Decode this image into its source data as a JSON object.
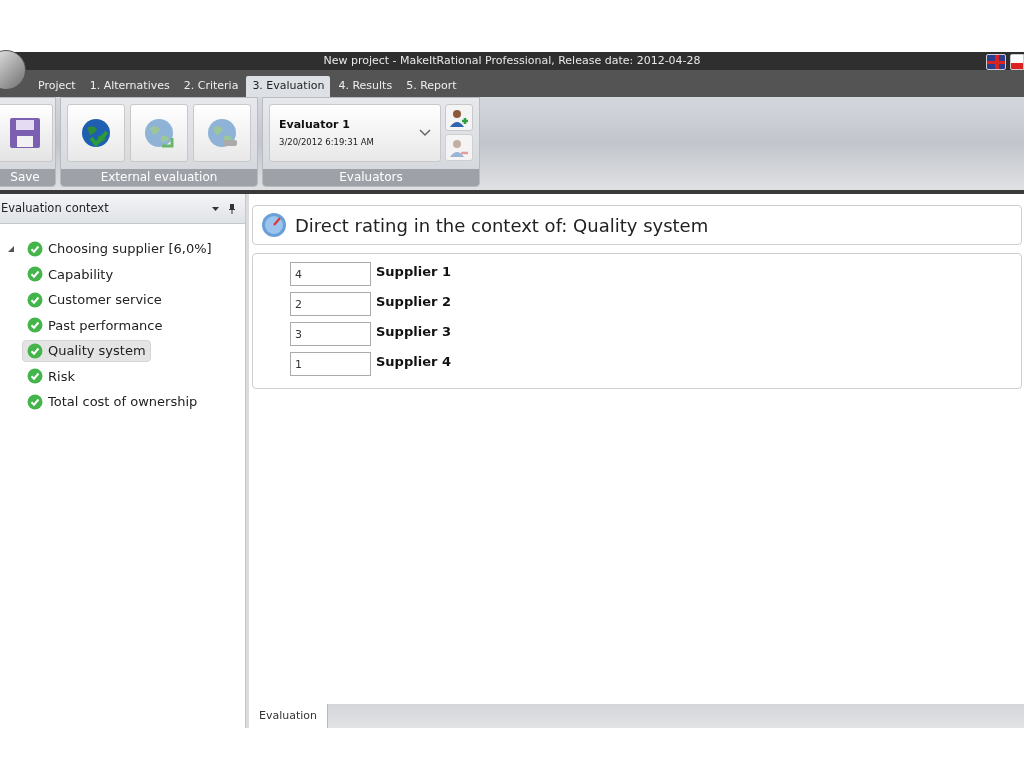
{
  "window": {
    "title": "New project - MakeItRational Professional, Release date: 2012-04-28"
  },
  "tabs": [
    {
      "label": "Project",
      "selected": false
    },
    {
      "label": "1. Alternatives",
      "selected": false
    },
    {
      "label": "2. Criteria",
      "selected": false
    },
    {
      "label": "3. Evaluation",
      "selected": true
    },
    {
      "label": "4. Results",
      "selected": false
    },
    {
      "label": "5. Report",
      "selected": false
    }
  ],
  "ribbon": {
    "groups": [
      {
        "label": "Save",
        "kind": "save",
        "buttons": [
          {
            "kind": "save"
          }
        ]
      },
      {
        "label": "External evaluation",
        "kind": "external",
        "buttons": [
          {
            "kind": "send"
          },
          {
            "kind": "import"
          },
          {
            "kind": "sync"
          }
        ]
      },
      {
        "label": "Evaluators",
        "kind": "evaluators",
        "evaluator": {
          "name": "Evaluator 1",
          "date": "3/20/2012 6:19:31 AM"
        }
      }
    ]
  },
  "sidebar": {
    "title": "Evaluation context",
    "tree": [
      {
        "label": "Choosing supplier [6,0%]",
        "selected": false,
        "expanded": true,
        "children": [
          {
            "label": "Capability",
            "selected": false
          },
          {
            "label": "Customer service",
            "selected": false
          },
          {
            "label": "Past performance",
            "selected": false
          },
          {
            "label": "Quality system",
            "selected": true
          },
          {
            "label": "Risk",
            "selected": false
          },
          {
            "label": "Total cost of ownership",
            "selected": false
          }
        ]
      }
    ]
  },
  "main": {
    "heading": "Direct rating in the context of: Quality system",
    "ratings": [
      {
        "value": "4",
        "label": "Supplier 1"
      },
      {
        "value": "2",
        "label": "Supplier 2"
      },
      {
        "value": "3",
        "label": "Supplier 3"
      },
      {
        "value": "1",
        "label": "Supplier 4"
      }
    ]
  },
  "bottom_tabs": [
    {
      "label": "Evaluation",
      "selected": true
    }
  ]
}
